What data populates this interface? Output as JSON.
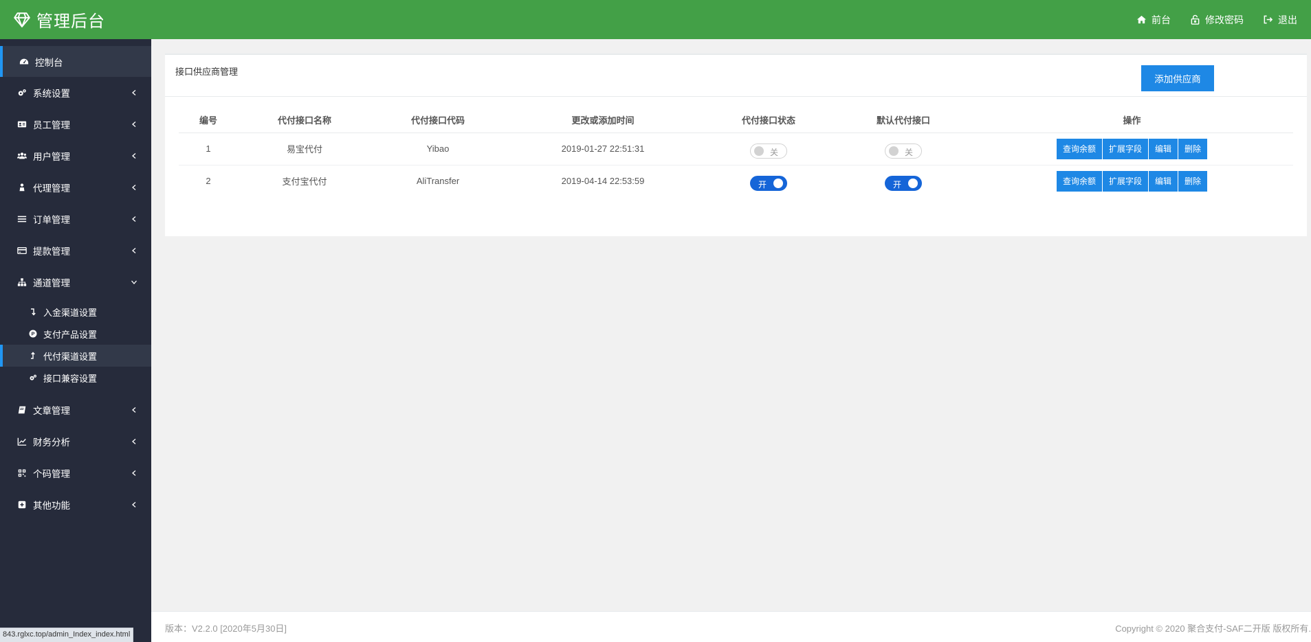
{
  "header": {
    "title": "管理后台",
    "nav": [
      {
        "label": "前台",
        "icon": "home-icon"
      },
      {
        "label": "修改密码",
        "icon": "lock-icon"
      },
      {
        "label": "退出",
        "icon": "sign-out-icon"
      }
    ]
  },
  "sidebar": {
    "items": [
      {
        "label": "控制台",
        "icon": "dashboard-icon"
      },
      {
        "label": "系统设置",
        "icon": "gears-icon"
      },
      {
        "label": "员工管理",
        "icon": "id-card-icon"
      },
      {
        "label": "用户管理",
        "icon": "users-icon"
      },
      {
        "label": "代理管理",
        "icon": "agent-icon"
      },
      {
        "label": "订单管理",
        "icon": "list-icon"
      },
      {
        "label": "提款管理",
        "icon": "credit-card-icon"
      },
      {
        "label": "通道管理",
        "icon": "sitemap-icon"
      },
      {
        "label": "文章管理",
        "icon": "book-icon"
      },
      {
        "label": "财务分析",
        "icon": "line-chart-icon"
      },
      {
        "label": "个码管理",
        "icon": "qrcode-icon"
      },
      {
        "label": "其他功能",
        "icon": "plus-square-icon"
      }
    ],
    "channel_submenu": [
      {
        "label": "入金渠道设置",
        "icon": "level-down-icon"
      },
      {
        "label": "支付产品设置",
        "icon": "product-icon"
      },
      {
        "label": "代付渠道设置",
        "icon": "level-up-icon"
      },
      {
        "label": "接口兼容设置",
        "icon": "gears-icon"
      }
    ]
  },
  "main": {
    "panel_title": "接口供应商管理",
    "add_button": "添加供应商",
    "table": {
      "headers": [
        "编号",
        "代付接口名称",
        "代付接口代码",
        "更改或添加时间",
        "代付接口状态",
        "默认代付接口",
        "操作"
      ],
      "rows": [
        {
          "id": "1",
          "name": "易宝代付",
          "code": "Yibao",
          "time": "2019-01-27 22:51:31",
          "status": "关",
          "status_on": false,
          "default": "关",
          "default_on": false
        },
        {
          "id": "2",
          "name": "支付宝代付",
          "code": "AliTransfer",
          "time": "2019-04-14 22:53:59",
          "status": "开",
          "status_on": true,
          "default": "开",
          "default_on": true
        }
      ],
      "actions": [
        "查询余额",
        "扩展字段",
        "编辑",
        "删除"
      ]
    }
  },
  "footer": {
    "version": "版本：V2.2.0 [2020年5月30日]",
    "copyright": "Copyright © 2020 聚合支付-SAF二开版 版权所有."
  },
  "status_bar_url": "843.rglxc.top/admin_Index_index.html",
  "colors": {
    "header_bg": "#43a047",
    "sidebar_bg": "#262b3b",
    "accent": "#1e88e5",
    "switch_on": "#1565d8"
  }
}
